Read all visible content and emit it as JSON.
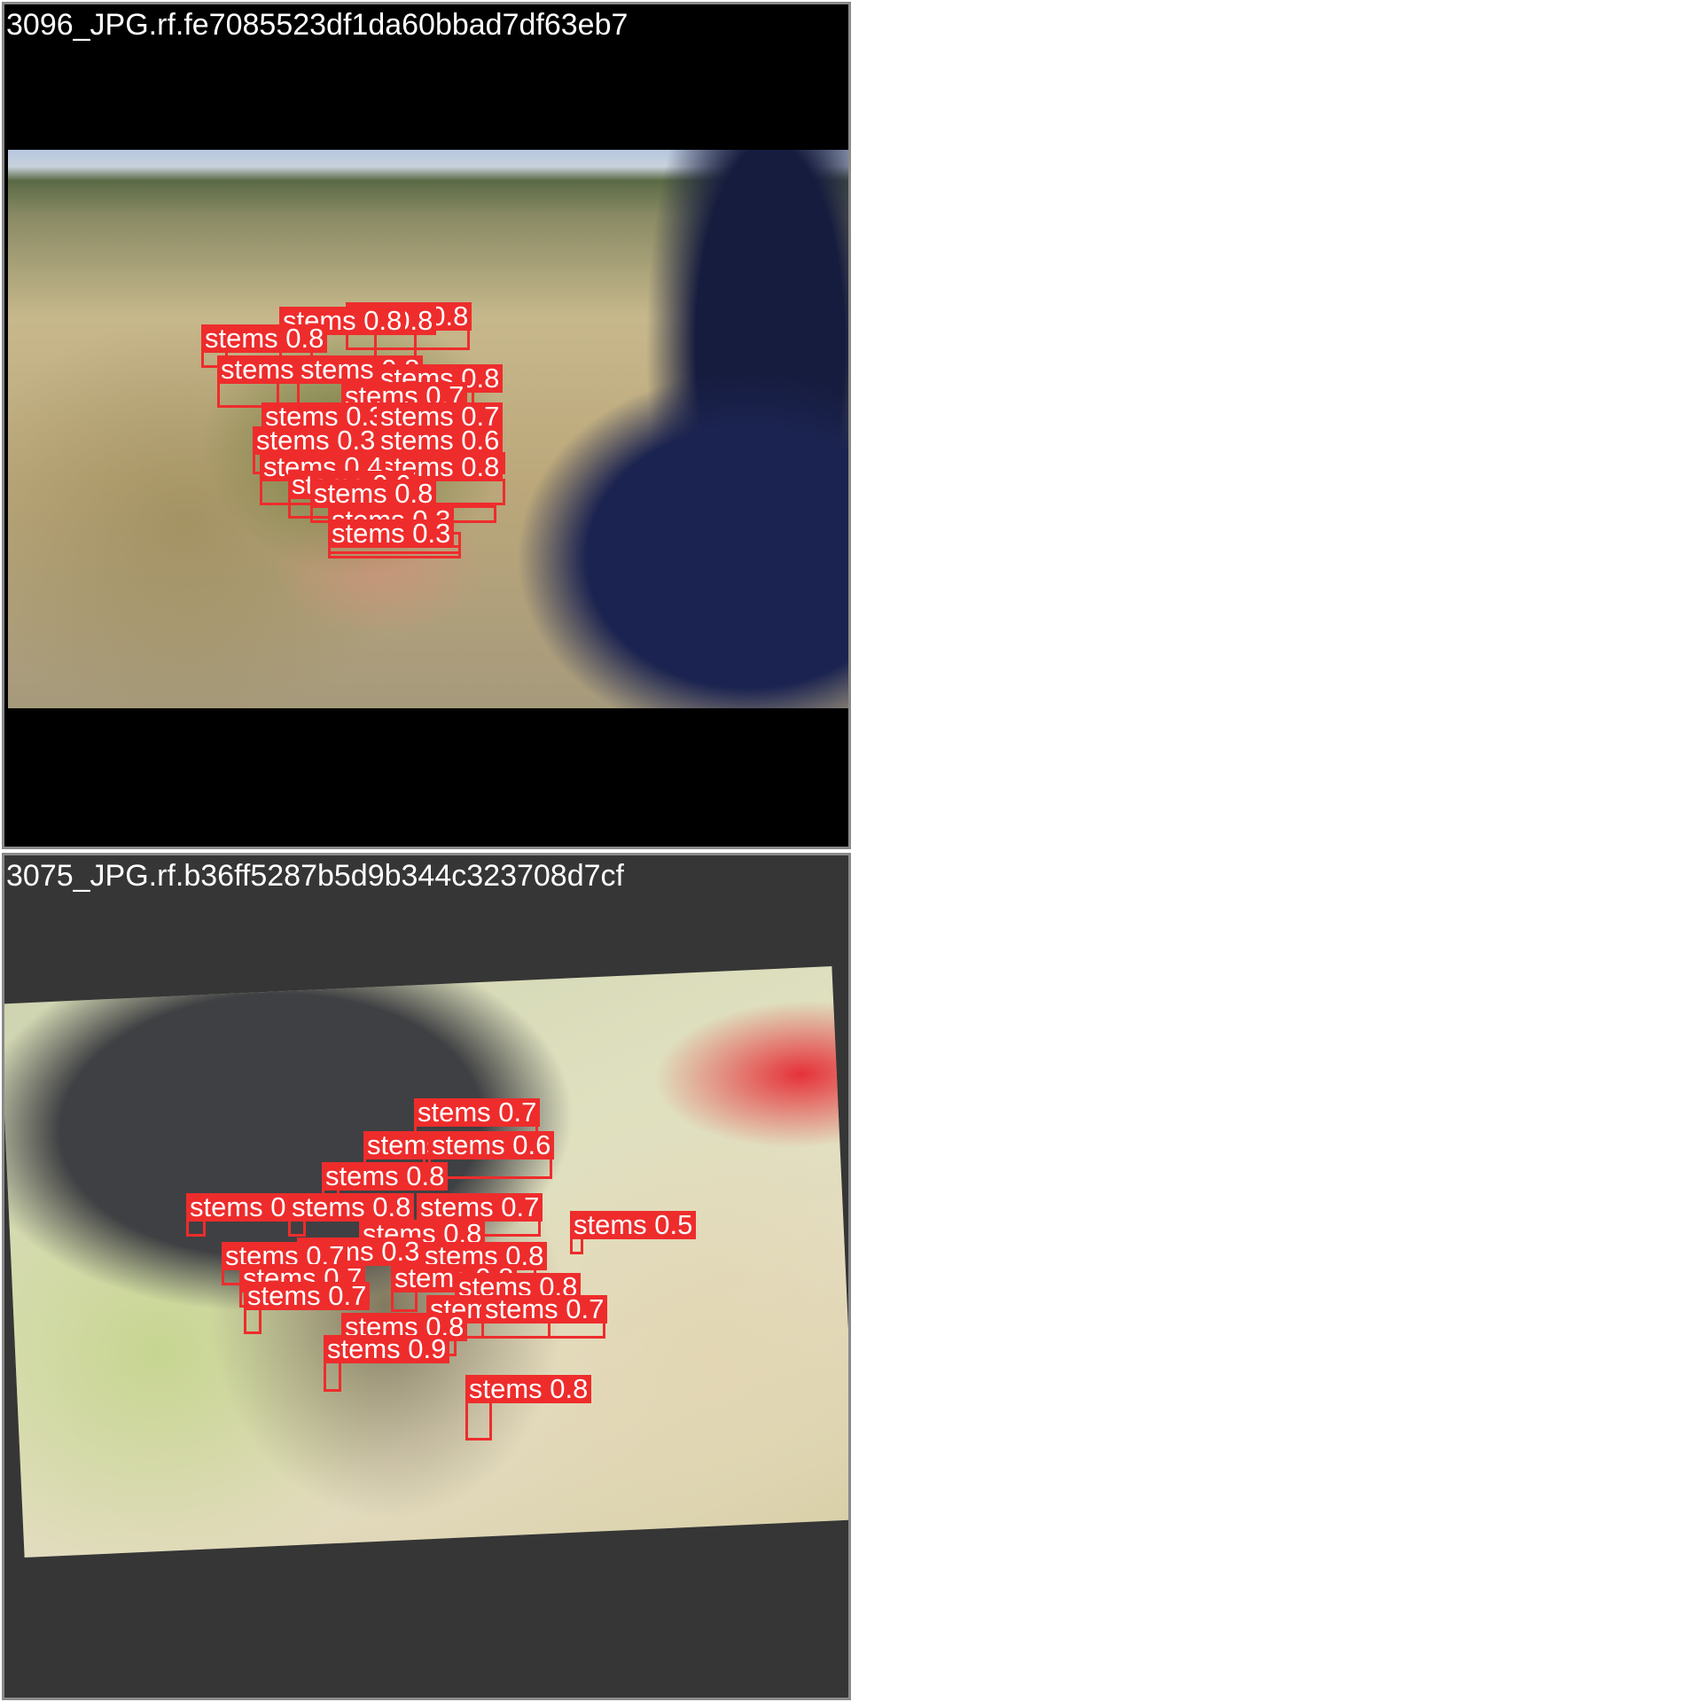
{
  "tiles": [
    {
      "title": "3096_JPG.rf.fe7085523df1da60bbad7df63eb7",
      "detections": [
        {
          "label": "stems 0.8"
        },
        {
          "label": "stems 0.8"
        },
        {
          "label": "stems 0.8"
        },
        {
          "label": "stems 0.8"
        },
        {
          "label": "stems 0.3"
        },
        {
          "label": "stems 0.8"
        },
        {
          "label": "stems 0.8"
        },
        {
          "label": "stems 0.7"
        },
        {
          "label": "stems 0.3"
        },
        {
          "label": "stems 0.7"
        },
        {
          "label": "stems 0.3"
        },
        {
          "label": "stems 0.6"
        },
        {
          "label": "stems 0.8"
        },
        {
          "label": "stems 0.4"
        },
        {
          "label": "stems 0.6"
        },
        {
          "label": "stems 0.8"
        },
        {
          "label": "stems 0.3"
        },
        {
          "label": "stems 0.3"
        }
      ]
    },
    {
      "title": "3075_JPG.rf.b36ff5287b5d9b344c323708d7cf",
      "detections": [
        {
          "label": "stems 0.7"
        },
        {
          "label": "stems 0.7"
        },
        {
          "label": "stems 0.6"
        },
        {
          "label": "stems 0.8"
        },
        {
          "label": "stems 0.7"
        },
        {
          "label": "stems 0.8"
        },
        {
          "label": "stems 0.7"
        },
        {
          "label": "stems 0.5"
        },
        {
          "label": "stems 0.8"
        },
        {
          "label": "stems 0.3"
        },
        {
          "label": "stems 0.8"
        },
        {
          "label": "stems 0.7"
        },
        {
          "label": "stems 0.7"
        },
        {
          "label": "stems 0.8"
        },
        {
          "label": "stems 0.8"
        },
        {
          "label": "stems 0.7"
        },
        {
          "label": "stems 0.9"
        },
        {
          "label": "stems 0.7"
        },
        {
          "label": "stems 0.8"
        },
        {
          "label": "stems 0.9"
        },
        {
          "label": "stems 0.8"
        }
      ]
    }
  ]
}
